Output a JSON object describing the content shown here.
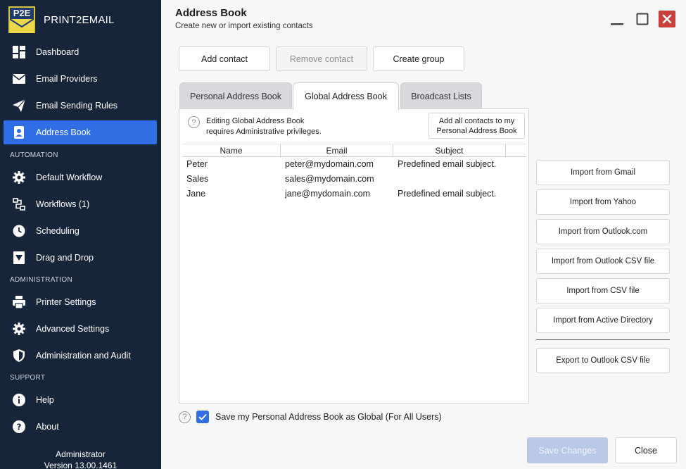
{
  "app": {
    "logo_text": "P2E",
    "name": "PRINT2EMAIL"
  },
  "sidebar": {
    "items": [
      {
        "label": "Dashboard",
        "icon": "dashboard-icon"
      },
      {
        "label": "Email Providers",
        "icon": "envelope-icon"
      },
      {
        "label": "Email Sending Rules",
        "icon": "paper-plane-icon"
      },
      {
        "label": "Address Book",
        "icon": "contact-card-icon",
        "active": true
      }
    ],
    "section_automation": "AUTOMATION",
    "automation_items": [
      {
        "label": "Default Workflow",
        "icon": "gear-icon"
      },
      {
        "label": "Workflows (1)",
        "icon": "workflow-icon"
      },
      {
        "label": "Scheduling",
        "icon": "clock-icon"
      },
      {
        "label": "Drag and Drop",
        "icon": "drop-icon"
      }
    ],
    "section_administration": "ADMINISTRATION",
    "administration_items": [
      {
        "label": "Printer Settings",
        "icon": "printer-icon"
      },
      {
        "label": "Advanced Settings",
        "icon": "gear-icon"
      },
      {
        "label": "Administration and Audit",
        "icon": "shield-icon"
      }
    ],
    "section_support": "SUPPORT",
    "support_items": [
      {
        "label": "Help",
        "icon": "info-icon"
      },
      {
        "label": "About",
        "icon": "question-icon"
      }
    ],
    "user": "Administrator",
    "version": "Version 13.00.1461"
  },
  "header": {
    "title": "Address Book",
    "subtitle": "Create new or import existing contacts"
  },
  "toolbar": {
    "add_contact": "Add contact",
    "remove_contact": "Remove contact",
    "create_group": "Create group"
  },
  "tabs": [
    {
      "label": "Personal Address Book",
      "active": false
    },
    {
      "label": "Global Address Book",
      "active": true
    },
    {
      "label": "Broadcast Lists",
      "active": false
    }
  ],
  "panel": {
    "info_line1": "Editing Global Address Book",
    "info_line2": "requires Administrative privileges.",
    "add_all_line1": "Add all contacts to my",
    "add_all_line2": "Personal Address Book"
  },
  "table": {
    "columns": [
      "Name",
      "Email",
      "Subject"
    ],
    "rows": [
      {
        "name": "Peter",
        "email": "peter@mydomain.com",
        "subject": "Predefined email subject."
      },
      {
        "name": "Sales",
        "email": "sales@mydomain.com",
        "subject": ""
      },
      {
        "name": "Jane",
        "email": "jane@mydomain.com",
        "subject": "Predefined email subject."
      }
    ]
  },
  "import": {
    "gmail": "Import from Gmail",
    "yahoo": "Import from Yahoo",
    "outlook_com": "Import from Outlook.com",
    "outlook_csv": "Import from Outlook CSV file",
    "csv": "Import from CSV file",
    "active_directory": "Import from Active Directory",
    "export_outlook_csv": "Export to Outlook CSV file"
  },
  "footer": {
    "save_global_label": "Save my Personal Address Book as Global (For All Users)",
    "save_global_checked": true,
    "save_changes": "Save Changes",
    "close": "Close"
  },
  "colors": {
    "sidebar_bg": "#17253a",
    "accent": "#2f6ee5",
    "close_red": "#c8403a"
  }
}
